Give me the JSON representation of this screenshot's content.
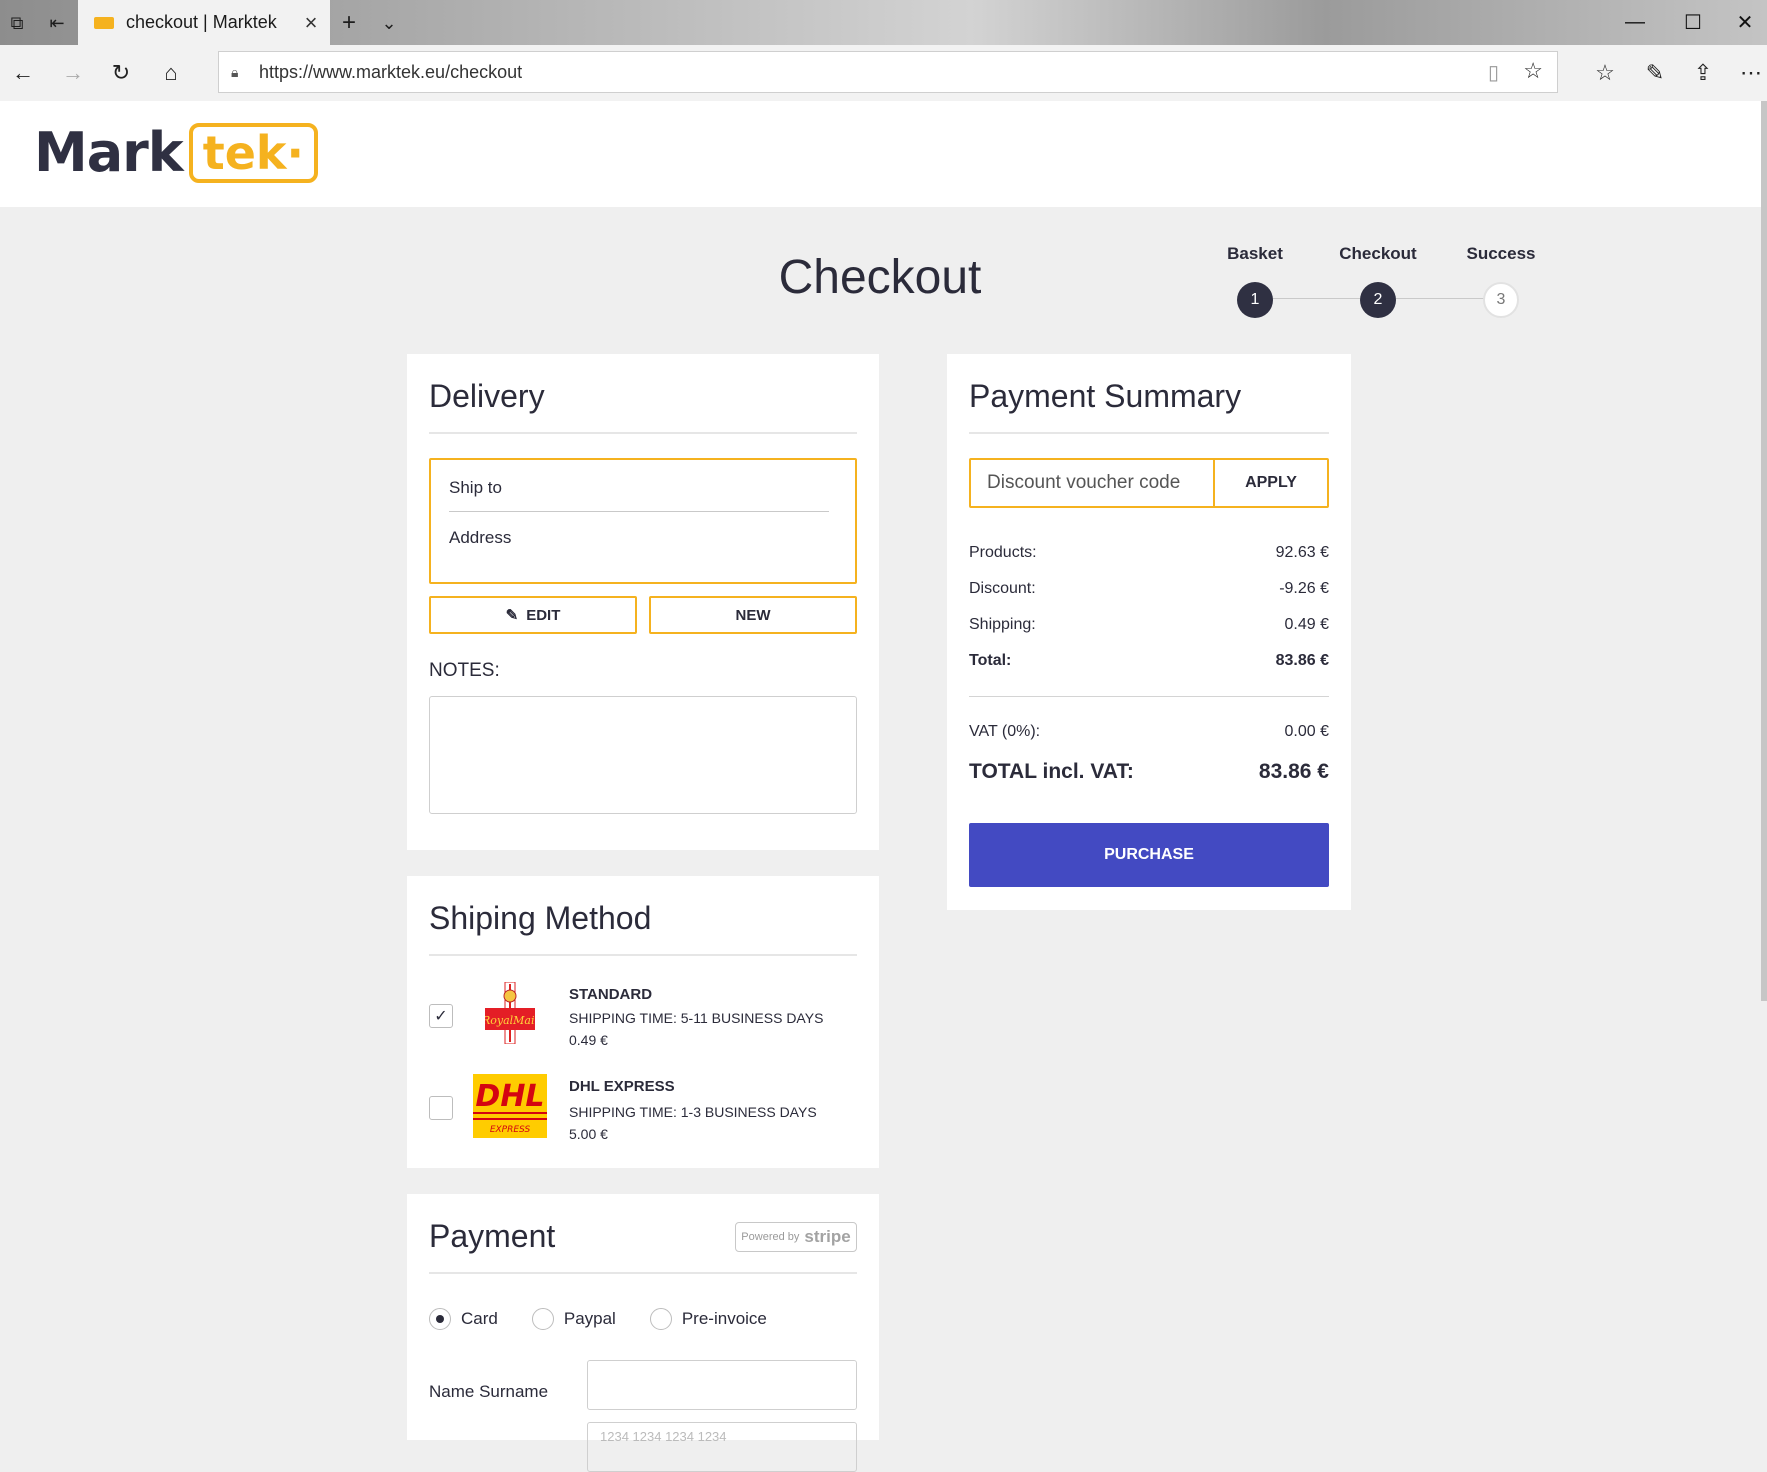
{
  "browser": {
    "tab_title": "checkout | Marktek",
    "url": "https://www.marktek.eu/checkout"
  },
  "site": {
    "logo_left": "Mark",
    "logo_right": "tek·"
  },
  "page": {
    "title": "Checkout"
  },
  "steps": [
    {
      "label": "Basket",
      "number": "1",
      "state": "done"
    },
    {
      "label": "Checkout",
      "number": "2",
      "state": "current"
    },
    {
      "label": "Success",
      "number": "3",
      "state": "todo"
    }
  ],
  "delivery": {
    "heading": "Delivery",
    "ship_to": "Ship to",
    "address": "Address",
    "edit_label": "EDIT",
    "new_label": "NEW",
    "notes_label": "NOTES:"
  },
  "shipping": {
    "heading": "Shiping Method",
    "options": [
      {
        "name": "STANDARD",
        "time": "SHIPPING TIME: 5-11 BUSINESS DAYS",
        "price": "0.49 €",
        "checked": true,
        "logo": "royal-mail-logo"
      },
      {
        "name": "DHL EXPRESS",
        "time": "SHIPPING TIME: 1-3 BUSINESS DAYS",
        "price": "5.00 €",
        "checked": false,
        "logo": "dhl-logo"
      }
    ]
  },
  "payment": {
    "heading": "Payment",
    "stripe_small": "Powered by",
    "stripe_brand": "stripe",
    "methods": [
      {
        "label": "Card",
        "selected": true
      },
      {
        "label": "Paypal",
        "selected": false
      },
      {
        "label": "Pre-invoice",
        "selected": false
      }
    ],
    "name_label": "Name Surname",
    "card_placeholder": "1234 1234 1234 1234"
  },
  "summary": {
    "heading": "Payment Summary",
    "voucher_placeholder": "Discount voucher code",
    "apply_label": "APPLY",
    "products_label": "Products:",
    "products_value": "92.63 €",
    "discount_label": "Discount:",
    "discount_value": "-9.26 €",
    "shipping_label": "Shipping:",
    "shipping_value": "0.49 €",
    "total_label": "Total:",
    "total_value": "83.86 €",
    "vat_label": "VAT (0%):",
    "vat_value": "0.00 €",
    "total_incl_label": "TOTAL incl. VAT:",
    "total_incl_value": "83.86 €",
    "purchase_label": "PURCHASE"
  },
  "colors": {
    "accent": "#f5b21f",
    "primary_button": "#434ac2",
    "dark": "#2f3042"
  }
}
